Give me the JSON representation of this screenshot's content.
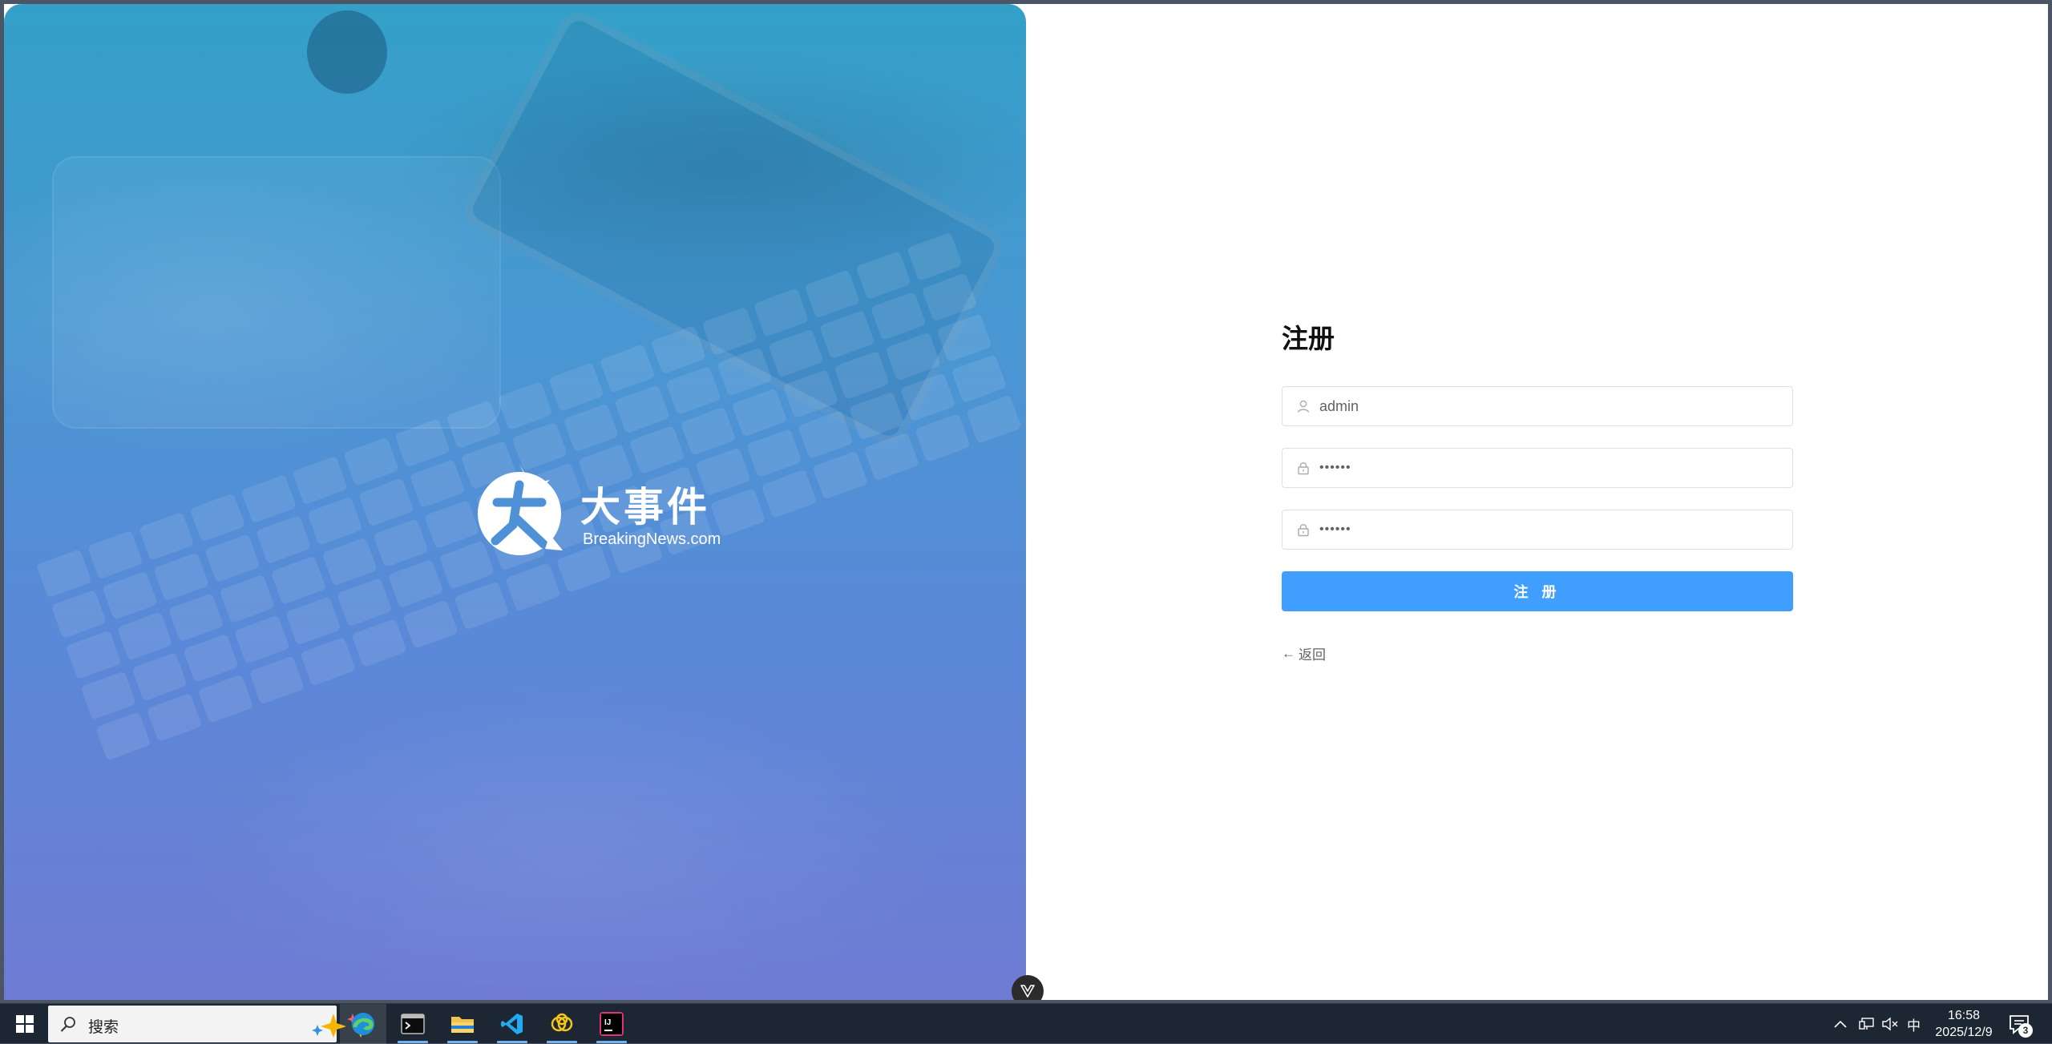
{
  "banner": {
    "logo_cn": "大事件",
    "logo_en": "BreakingNews.com"
  },
  "form": {
    "title": "注册",
    "username_value": "admin",
    "password_value": "••••••",
    "repassword_value": "••••••",
    "submit_label": "注 册",
    "back_label": "返回",
    "back_arrow": "←"
  },
  "taskbar": {
    "search_text": "搜索",
    "ime_label": "中",
    "time": "16:58",
    "date": "2025/12/9",
    "notification_count": "3",
    "apps": [
      "edge-icon",
      "terminal-icon",
      "file-explorer-icon",
      "vscode-icon",
      "baidu-netdisk-icon",
      "intellij-idea-icon"
    ]
  },
  "colors": {
    "primary_button": "#409eff",
    "banner_top": "#34a0c8",
    "banner_bottom": "#6f7bd3",
    "taskbar": "#1c2733"
  }
}
